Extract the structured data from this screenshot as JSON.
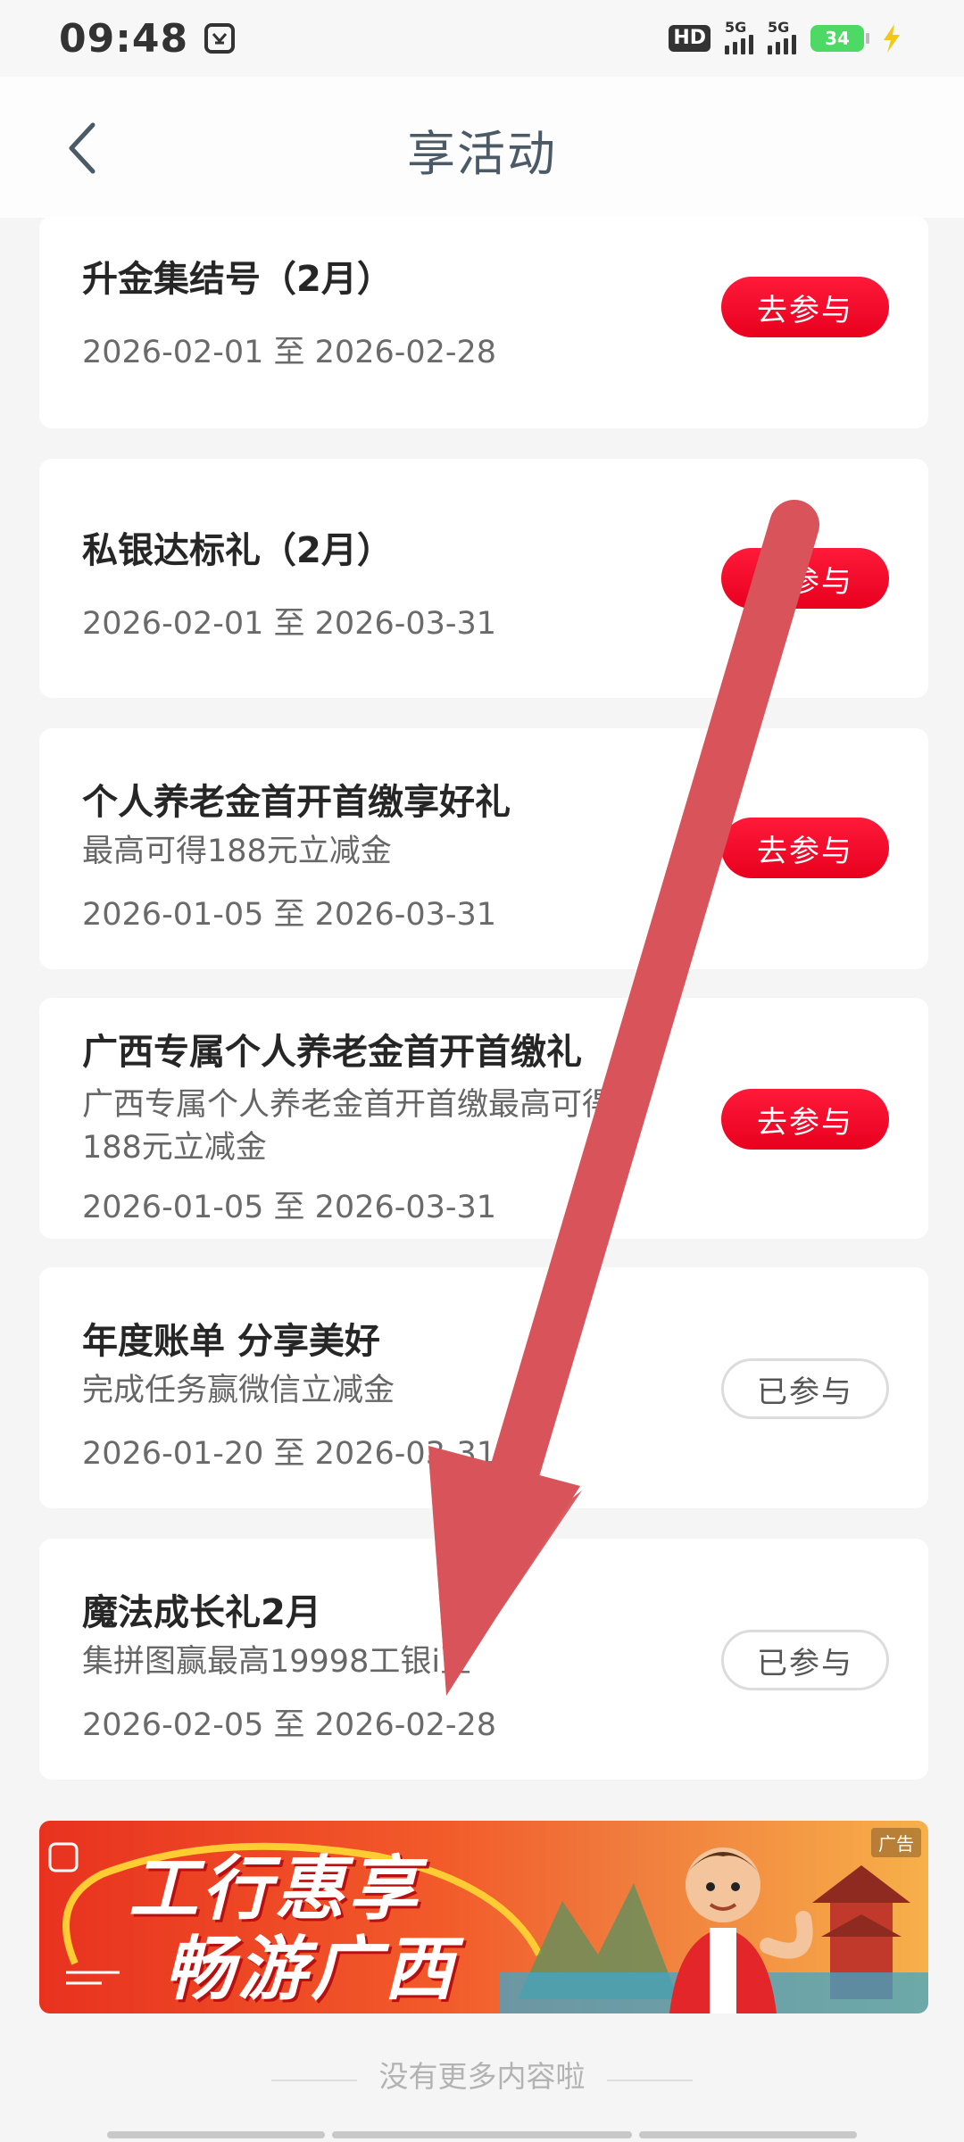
{
  "status_bar": {
    "time": "09:48",
    "hd_label": "HD",
    "signal_label_1": "5G",
    "signal_label_2": "5G",
    "battery_level": "34"
  },
  "header": {
    "title": "享活动"
  },
  "activities": [
    {
      "title": "升金集结号（2月）",
      "description": "",
      "date": "2026-02-01 至 2026-02-28",
      "button": "去参与",
      "status": "join"
    },
    {
      "title": "私银达标礼（2月）",
      "description": "",
      "date": "2026-02-01 至 2026-03-31",
      "button": "去参与",
      "status": "join"
    },
    {
      "title": "个人养老金首开首缴享好礼",
      "description": "最高可得188元立减金",
      "date": "2026-01-05 至 2026-03-31",
      "button": "去参与",
      "status": "join"
    },
    {
      "title": "广西专属个人养老金首开首缴礼",
      "description": "广西专属个人养老金首开首缴最高可得188元立减金",
      "date": "2026-01-05 至 2026-03-31",
      "button": "去参与",
      "status": "join"
    },
    {
      "title": "年度账单 分享美好",
      "description": "完成任务赢微信立减金",
      "date": "2026-01-20 至 2026-03-31",
      "button": "已参与",
      "status": "joined"
    },
    {
      "title": "魔法成长礼2月",
      "description": "集拼图赢最高19998工银i豆",
      "date": "2026-02-05 至 2026-02-28",
      "button": "已参与",
      "status": "joined"
    }
  ],
  "banner": {
    "line1": "工行惠享",
    "line2": "畅游广西",
    "ad_tag": "广告"
  },
  "footer": {
    "no_more": "没有更多内容啦"
  },
  "colors": {
    "primary_red": "#e8001e",
    "overlay_arrow": "#d9545a",
    "title_text": "#4a5a66"
  }
}
